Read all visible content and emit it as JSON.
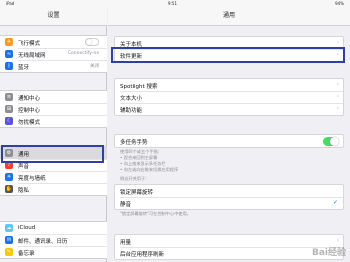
{
  "status": {
    "left": "iPad",
    "time": "9:51",
    "right": "94%"
  },
  "sidebar": {
    "title": "设置",
    "group1": [
      {
        "label": "飞行模式",
        "icon": "airplane-icon",
        "color": "#f89a1c",
        "value": ""
      },
      {
        "label": "无线局域网",
        "icon": "wifi-icon",
        "color": "#1a74e8",
        "value": "Connectify-nx"
      },
      {
        "label": "蓝牙",
        "icon": "bluetooth-icon",
        "color": "#1a74e8",
        "value": "关闭"
      }
    ],
    "group2": [
      {
        "label": "通知中心",
        "icon": "notification-icon",
        "color": "#8e8e93"
      },
      {
        "label": "控制中心",
        "icon": "control-center-icon",
        "color": "#8e8e93"
      },
      {
        "label": "勿扰模式",
        "icon": "moon-icon",
        "color": "#5856d6"
      }
    ],
    "group3": [
      {
        "label": "通用",
        "icon": "gear-icon",
        "color": "#8e8e93"
      },
      {
        "label": "声音",
        "icon": "sound-icon",
        "color": "#ff3b30"
      },
      {
        "label": "亮度与墙纸",
        "icon": "brightness-icon",
        "color": "#1a74e8"
      },
      {
        "label": "隐私",
        "icon": "hand-icon",
        "color": "#555"
      }
    ],
    "group4": [
      {
        "label": "iCloud",
        "icon": "cloud-icon",
        "color": "#5ac8fa"
      },
      {
        "label": "邮件、通讯录、日历",
        "icon": "mail-icon",
        "color": "#1a74e8"
      },
      {
        "label": "备忘录",
        "icon": "notes-icon",
        "color": "#f7c900"
      }
    ]
  },
  "main": {
    "title": "通用",
    "group1": [
      "关于本机",
      "软件更新"
    ],
    "group2": [
      "Spotlight 搜索",
      "文本大小",
      "辅助功能"
    ],
    "multitask": {
      "label": "多任务手势",
      "notes": [
        "使用四个或五个手指：",
        "• 捏合来回到主屏幕",
        "• 向上推来显示多任务栏",
        "• 向左或向右推来切换应用程序"
      ]
    },
    "side_switch_header": "侧边开关用于：",
    "group4": [
      {
        "label": "锁定屏幕旋转",
        "checked": false
      },
      {
        "label": "静音",
        "checked": true
      }
    ],
    "side_switch_note": "\"锁定屏幕旋转\"可在控制中心中使用。",
    "group5": [
      "用量",
      "后台应用程序刷新"
    ],
    "check_glyph": "✓",
    "chevron": "›"
  },
  "watermark": "Bai经验"
}
